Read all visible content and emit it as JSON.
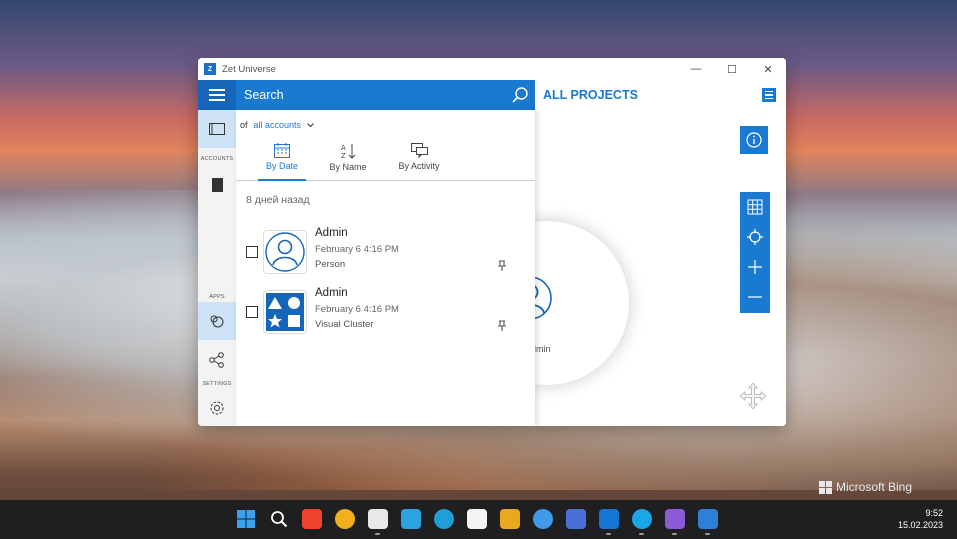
{
  "window": {
    "title": "Zet Universe",
    "logo_glyph": "Z",
    "minimize_glyph": "—",
    "maximize_glyph": "☐",
    "close_glyph": "✕"
  },
  "appbar": {
    "search_placeholder": "Search",
    "projects_title": "ALL PROJECTS"
  },
  "rail": {
    "accounts_label": "ACCOUNTS",
    "apps_label": "APPS",
    "settings_label": "SETTINGS"
  },
  "panel": {
    "of_label": "of",
    "accounts_filter": "all accounts",
    "sort_tabs": [
      {
        "label": "By Date",
        "icon": "calendar-icon",
        "active": true
      },
      {
        "label": "By Name",
        "icon": "sort-az-icon",
        "active": false
      },
      {
        "label": "By Activity",
        "icon": "chat-icon",
        "active": false
      }
    ],
    "group_header": "8 дней назад",
    "items": [
      {
        "name": "Admin",
        "date": "February 6 4:16 PM",
        "type": "Person",
        "icon": "person-icon"
      },
      {
        "name": "Admin",
        "date": "February 6 4:16 PM",
        "type": "Visual Cluster",
        "icon": "shapes-icon"
      }
    ]
  },
  "canvas": {
    "node_label": "Admin"
  },
  "desktop": {
    "bing_text": "Microsoft Bing"
  },
  "taskbar": {
    "time": "9:52",
    "date": "15.02.2023",
    "icons": [
      {
        "name": "start-icon",
        "color": "#3aa0f0"
      },
      {
        "name": "search-icon",
        "color": "#1f1f22"
      },
      {
        "name": "yandex-icon",
        "color": "#f0452c"
      },
      {
        "name": "file-explorer-icon",
        "color": "#f2b01e"
      },
      {
        "name": "store-icon",
        "color": "#e8e8e8"
      },
      {
        "name": "telegram-icon",
        "color": "#2aa3df"
      },
      {
        "name": "edge-icon",
        "color": "#1e9fd8"
      },
      {
        "name": "yandex-browser-icon",
        "color": "#f4f4f4"
      },
      {
        "name": "chrome-icon",
        "color": "#e9a91f"
      },
      {
        "name": "notepad-icon",
        "color": "#3f9be8"
      },
      {
        "name": "floppy-icon",
        "color": "#4a6fd6"
      },
      {
        "name": "outlook-icon",
        "color": "#1476d2"
      },
      {
        "name": "skype-icon",
        "color": "#1aa7e8"
      },
      {
        "name": "visual-studio-icon",
        "color": "#8c5ad6"
      },
      {
        "name": "zet-universe-icon",
        "color": "#2e7fd6"
      }
    ]
  }
}
